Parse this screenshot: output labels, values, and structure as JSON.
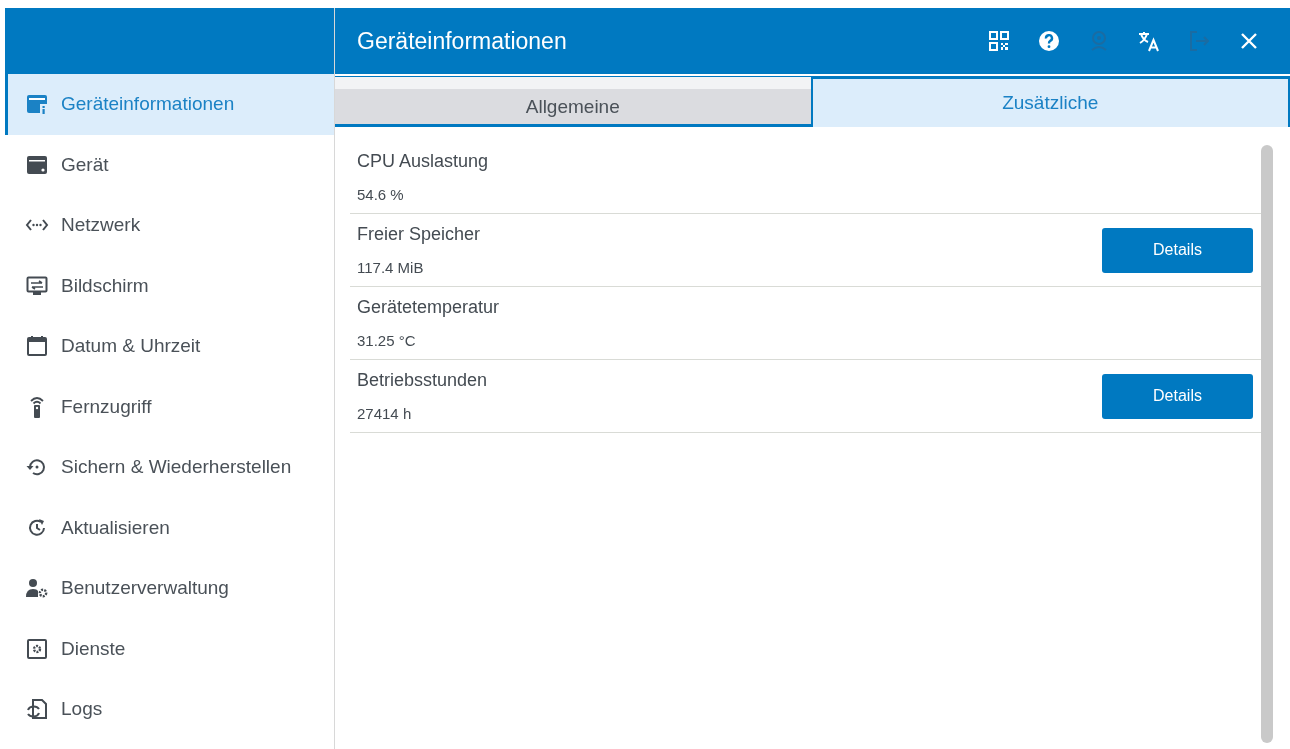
{
  "header": {
    "title": "Geräteinformationen"
  },
  "toolbar": [
    {
      "kind": "qr",
      "disabled": false
    },
    {
      "kind": "help",
      "disabled": false
    },
    {
      "kind": "webcam",
      "disabled": true
    },
    {
      "kind": "translate",
      "disabled": false
    },
    {
      "kind": "logout",
      "disabled": true
    },
    {
      "kind": "close",
      "disabled": false
    }
  ],
  "sidebar": {
    "items": [
      {
        "label": "Geräteinformationen",
        "kind": "info",
        "selected": true
      },
      {
        "label": "Gerät",
        "kind": "device",
        "selected": false
      },
      {
        "label": "Netzwerk",
        "kind": "network",
        "selected": false
      },
      {
        "label": "Bildschirm",
        "kind": "screen",
        "selected": false
      },
      {
        "label": "Datum & Uhrzeit",
        "kind": "calendar",
        "selected": false
      },
      {
        "label": "Fernzugriff",
        "kind": "remote",
        "selected": false
      },
      {
        "label": "Sichern & Wiederherstellen",
        "kind": "restore",
        "selected": false
      },
      {
        "label": "Aktualisieren",
        "kind": "update",
        "selected": false
      },
      {
        "label": "Benutzerverwaltung",
        "kind": "users",
        "selected": false
      },
      {
        "label": "Dienste",
        "kind": "services",
        "selected": false
      },
      {
        "label": "Logs",
        "kind": "logs",
        "selected": false
      }
    ]
  },
  "tabs": [
    {
      "label": "Allgemeine",
      "selected": false
    },
    {
      "label": "Zusätzliche",
      "selected": true
    }
  ],
  "rows": [
    {
      "label": "CPU Auslastung",
      "value": "54.6 %"
    },
    {
      "label": "Freier Speicher",
      "value": "117.4 MiB",
      "button": "Details"
    },
    {
      "label": "Gerätetemperatur",
      "value": "31.25 °C"
    },
    {
      "label": "Betriebsstunden",
      "value": "27414 h",
      "button": "Details"
    }
  ]
}
